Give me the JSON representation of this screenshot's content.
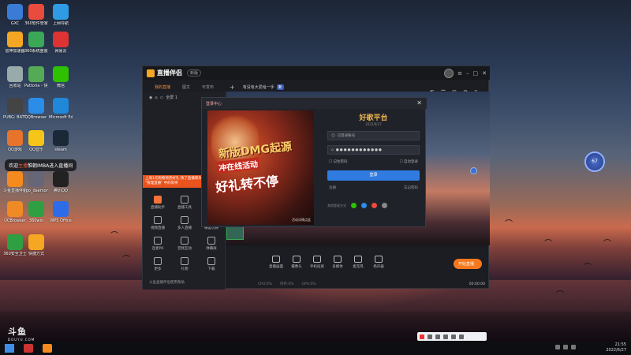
{
  "desktop": {
    "icons": [
      {
        "label": "GXC",
        "color": "#3a7bd5"
      },
      {
        "label": "360软件管家",
        "color": "#e94b3c"
      },
      {
        "label": "上网导航",
        "color": "#2f9be4"
      },
      {
        "label": "雷神加速器",
        "color": "#f5a623"
      },
      {
        "label": "360系统重装大师",
        "color": "#3aa857"
      },
      {
        "label": "网易云",
        "color": "#d33"
      },
      {
        "label": "回收站",
        "color": "#9aa"
      },
      {
        "label": "Pattoria - 快捷方式",
        "color": "#5a5"
      },
      {
        "label": "微信",
        "color": "#2dc100"
      },
      {
        "label": "PUBG: BATTLEGR...",
        "color": "#444"
      },
      {
        "label": "QQBrowser - 快捷方式",
        "color": "#2a8ee8"
      },
      {
        "label": "Microsoft Edge",
        "color": "#1f88d8"
      },
      {
        "label": "QQ游戏",
        "color": "#e8732a"
      },
      {
        "label": "QQ音乐",
        "color": "#f5c518"
      },
      {
        "label": "steam",
        "color": "#1b2838"
      },
      {
        "label": "斗鱼直播伴侣",
        "color": "#f58a1f"
      },
      {
        "label": "fgo_daemon - 快捷方式",
        "color": "#667"
      },
      {
        "label": "腾讯QQ",
        "color": "#222"
      },
      {
        "label": "UCBrowser",
        "color": "#f08a24"
      },
      {
        "label": "360win",
        "color": "#2ea043"
      },
      {
        "label": "WPS Office",
        "color": "#2e6be6"
      },
      {
        "label": "360安全卫士",
        "color": "#2ea043"
      },
      {
        "label": "快捷方式",
        "color": "#f5a623"
      }
    ]
  },
  "bubble": {
    "prefix": "欢迎",
    "highlight": "主播",
    "suffix": "惟朝IMBA进入直播间"
  },
  "app": {
    "title": "直播伴侣",
    "version_badge": "新版",
    "tabs": [
      "我的直播",
      "图文",
      "可发布"
    ],
    "scene": "有没有大爱给一手",
    "scene_badge": "新",
    "source_label": "全屏 1",
    "promo_text": "上周1元购物领券好礼 快了直播帮你 规律，现在 \"管理直播\" 中的等待",
    "tools": [
      {
        "label": "直播助手",
        "hot": true
      },
      {
        "label": "直播工具",
        "hot": false
      },
      {
        "label": "美颜",
        "hot": false
      },
      {
        "label": "视频直播",
        "hot": false
      },
      {
        "label": "多人直播",
        "hot": false
      },
      {
        "label": "横竖切换",
        "hot": false
      },
      {
        "label": "连麦PK",
        "hot": false
      },
      {
        "label": "音频互动",
        "hot": false
      },
      {
        "label": "弹幕屏",
        "hot": false
      },
      {
        "label": "更多",
        "hot": false
      },
      {
        "label": "礼物",
        "hot": false
      },
      {
        "label": "下载",
        "hot": false
      }
    ],
    "sidebar_footer": "斗鱼直播伴侣使用帮助",
    "controls": [
      "直播画面",
      "摄像头",
      "手机投屏",
      "多媒体",
      "麦克风",
      "扬声器"
    ],
    "start_button": "开始直播",
    "status": [
      "CPU:0%",
      "内存:0%",
      "GPU:0%"
    ],
    "rec_time": "00:00:00"
  },
  "dialog": {
    "title": "登录中心",
    "banner": {
      "line1": "新版DMG起源",
      "line2": "冲在线活动",
      "line3": "好礼转不停",
      "footer": "活动详情点此"
    },
    "brand": "好歌平台",
    "brand_sub": "2022/6/27",
    "username_placeholder": "已登录账号",
    "password_masked": "●●●●●●●●●●●●",
    "remember": "记住密码",
    "auto_login": "自动登录",
    "login_button": "登录",
    "register": "注册",
    "forgot": "忘记密码",
    "other_login": "其他登录方式"
  },
  "orb_label": "67",
  "watermark": {
    "logo": "斗鱼",
    "url": "DOUYU.COM"
  },
  "taskbar": {
    "time": "21:55",
    "date": "2022/6/27"
  }
}
